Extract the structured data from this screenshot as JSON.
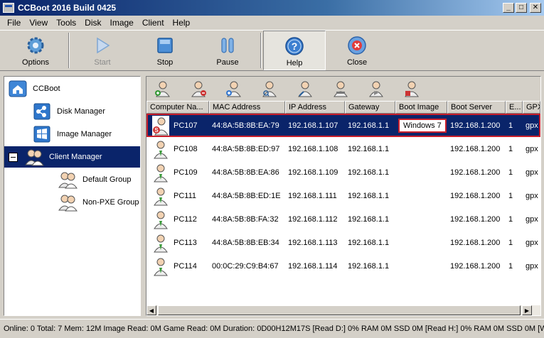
{
  "window": {
    "title": "CCBoot 2016 Build 0425",
    "minimize": "_",
    "maximize": "□",
    "close": "✕"
  },
  "menu": [
    "File",
    "View",
    "Tools",
    "Disk",
    "Image",
    "Client",
    "Help"
  ],
  "toolbar": {
    "options": "Options",
    "start": "Start",
    "stop": "Stop",
    "pause": "Pause",
    "help": "Help",
    "close": "Close"
  },
  "tree": {
    "root": "CCBoot",
    "disk_manager": "Disk Manager",
    "image_manager": "Image Manager",
    "client_manager": "Client Manager",
    "default_group": "Default Group",
    "non_pxe_group": "Non-PXE Group"
  },
  "grid": {
    "columns": [
      "Computer Na...",
      "MAC Address",
      "IP Address",
      "Gateway",
      "Boot Image",
      "Boot Server",
      "E...",
      "GPX"
    ],
    "rows": [
      {
        "name": "PC107",
        "mac": "44:8A:5B:8B:EA:79",
        "ip": "192.168.1.107",
        "gateway": "192.168.1.1",
        "boot_image": "Windows 7",
        "boot_server": "192.168.1.200",
        "e": "1",
        "gpx": "gpx"
      },
      {
        "name": "PC108",
        "mac": "44:8A:5B:8B:ED:97",
        "ip": "192.168.1.108",
        "gateway": "192.168.1.1",
        "boot_image": "",
        "boot_server": "192.168.1.200",
        "e": "1",
        "gpx": "gpx"
      },
      {
        "name": "PC109",
        "mac": "44:8A:5B:8B:EA:86",
        "ip": "192.168.1.109",
        "gateway": "192.168.1.1",
        "boot_image": "",
        "boot_server": "192.168.1.200",
        "e": "1",
        "gpx": "gpx"
      },
      {
        "name": "PC111",
        "mac": "44:8A:5B:8B:ED:1E",
        "ip": "192.168.1.111",
        "gateway": "192.168.1.1",
        "boot_image": "",
        "boot_server": "192.168.1.200",
        "e": "1",
        "gpx": "gpx"
      },
      {
        "name": "PC112",
        "mac": "44:8A:5B:8B:FA:32",
        "ip": "192.168.1.112",
        "gateway": "192.168.1.1",
        "boot_image": "",
        "boot_server": "192.168.1.200",
        "e": "1",
        "gpx": "gpx"
      },
      {
        "name": "PC113",
        "mac": "44:8A:5B:8B:EB:34",
        "ip": "192.168.1.113",
        "gateway": "192.168.1.1",
        "boot_image": "",
        "boot_server": "192.168.1.200",
        "e": "1",
        "gpx": "gpx"
      },
      {
        "name": "PC114",
        "mac": "00:0C:29:C9:B4:67",
        "ip": "192.168.1.114",
        "gateway": "192.168.1.1",
        "boot_image": "",
        "boot_server": "192.168.1.200",
        "e": "1",
        "gpx": "gpx"
      }
    ]
  },
  "status": "Online: 0 Total: 7 Mem: 12M Image Read: 0M Game Read: 0M Duration: 0D00H12M17S [Read D:] 0% RAM 0M SSD 0M [Read H:] 0% RAM 0M SSD 0M [W",
  "colors": {
    "selection": "#0a246a",
    "highlight_border": "#c81e2b",
    "chrome": "#d4d0c8"
  }
}
